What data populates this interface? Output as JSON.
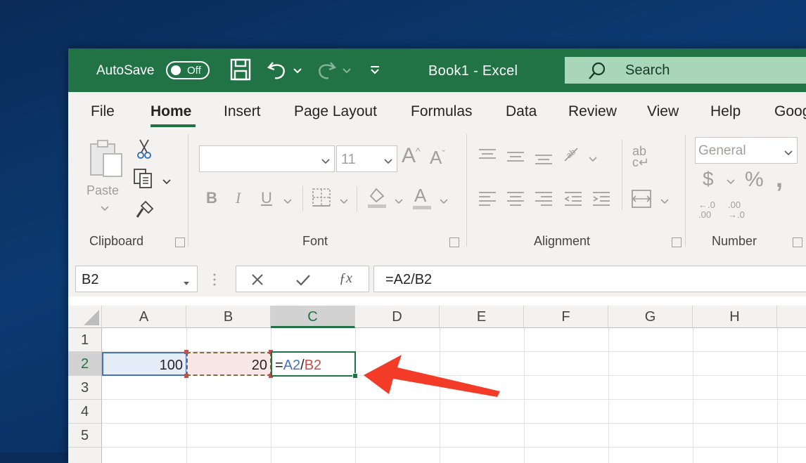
{
  "titlebar": {
    "autosave_label": "AutoSave",
    "autosave_state": "Off",
    "doc_title": "Book1  -  Excel",
    "search_label": "Search"
  },
  "menu_tabs": [
    "File",
    "Home",
    "Insert",
    "Page Layout",
    "Formulas",
    "Data",
    "Review",
    "View",
    "Help",
    "Goog"
  ],
  "active_tab": "Home",
  "ribbon": {
    "clipboard": {
      "paste_label": "Paste",
      "group_label": "Clipboard"
    },
    "font": {
      "font_name": "",
      "font_size": "11",
      "group_label": "Font"
    },
    "alignment": {
      "group_label": "Alignment"
    },
    "number": {
      "format": "General",
      "group_label": "Number"
    }
  },
  "formula_bar": {
    "name_box": "B2",
    "formula": "=A2/B2"
  },
  "sheet": {
    "columns": [
      "A",
      "B",
      "C",
      "D",
      "E",
      "F",
      "G",
      "H"
    ],
    "selected_column": "C",
    "rows": [
      "1",
      "2",
      "3",
      "4",
      "5"
    ],
    "selected_row": "2",
    "cells": {
      "A2": "100",
      "B2": "20",
      "C2_eq": "=",
      "C2_ref1": "A2",
      "C2_div": "/",
      "C2_ref2": "B2"
    }
  },
  "colors": {
    "excel_green": "#217346",
    "ref_blue": "#4472c4",
    "ref_red": "#c0504d",
    "arrow_red": "#f23c28"
  }
}
